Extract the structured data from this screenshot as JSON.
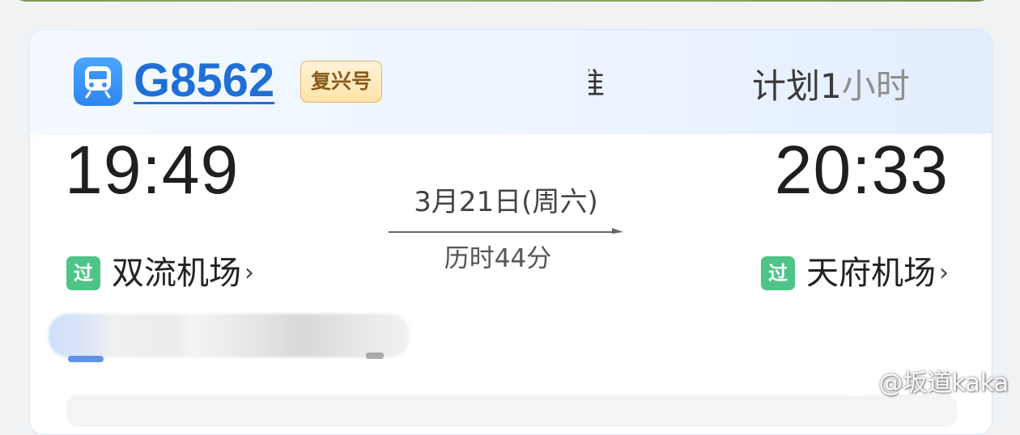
{
  "train": {
    "number": "G8562",
    "type_badge": "复兴号",
    "icon": "train-icon"
  },
  "header": {
    "fragment": "准",
    "plan_prefix": "计划1",
    "plan_suffix_faded": "小时"
  },
  "journey": {
    "departure_time": "19:49",
    "arrival_time": "20:33",
    "date": "3月21日(周六)",
    "duration": "历时44分",
    "departure_station": "双流机场",
    "arrival_station": "天府机场",
    "pass_badge": "过",
    "chevron": "›"
  },
  "watermark": "@坂道kaka",
  "colors": {
    "accent_blue": "#1f6fd6",
    "badge_gold": "#ffe3a8",
    "pass_green": "#4fc488"
  }
}
